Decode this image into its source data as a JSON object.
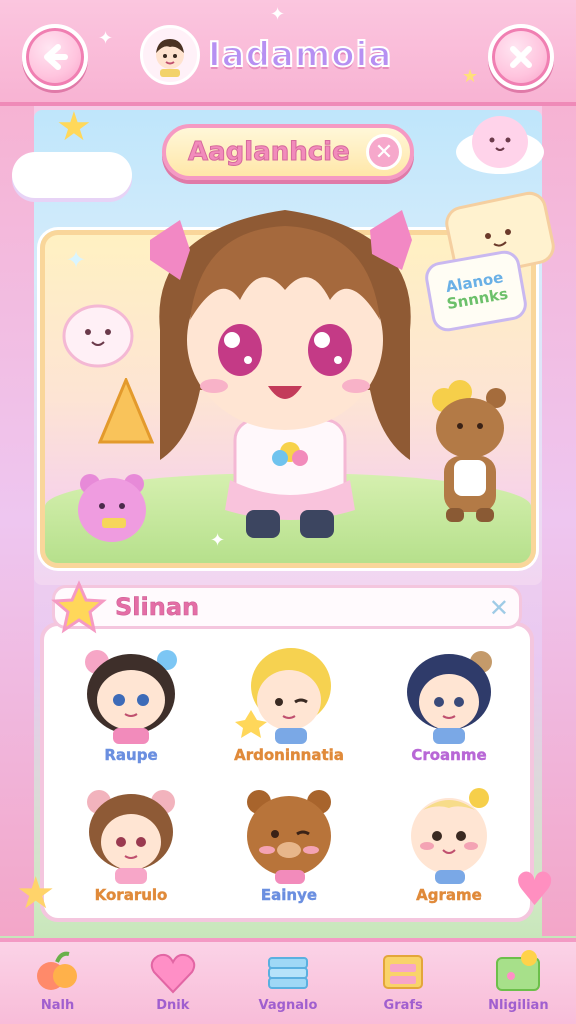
{
  "header": {
    "title": "Iadamoia",
    "back_icon": "back-arrow-icon",
    "close_icon": "x-icon"
  },
  "character": {
    "name": "Aaglanhcie",
    "speech_line1": "Alanoe",
    "speech_line2": "Snnnks"
  },
  "friends": {
    "title": "Slinan",
    "items": [
      {
        "label": "Raupe",
        "color": "#6b8fe0"
      },
      {
        "label": "Ardoninnatia",
        "color": "#e08a3a"
      },
      {
        "label": "Croanme",
        "color": "#b867d6"
      },
      {
        "label": "Korarulo",
        "color": "#e08a3a"
      },
      {
        "label": "Eainye",
        "color": "#6b8fe0"
      },
      {
        "label": "Agrame",
        "color": "#e08a3a"
      }
    ]
  },
  "nav": {
    "items": [
      {
        "label": "Nalh",
        "icon": "fruit-icon"
      },
      {
        "label": "Dnik",
        "icon": "heart-icon"
      },
      {
        "label": "Vagnalo",
        "icon": "stack-icon"
      },
      {
        "label": "Grafs",
        "icon": "drawer-icon"
      },
      {
        "label": "Nligilian",
        "icon": "map-icon"
      }
    ]
  },
  "colors": {
    "accent_pink": "#f59ac3",
    "title_purple": "#b690f2"
  }
}
